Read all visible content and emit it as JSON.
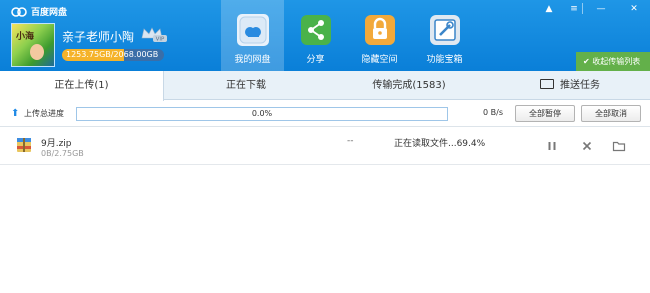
{
  "app": {
    "name": "百度网盘"
  },
  "window_controls": {
    "pin": "▲",
    "menu": "≡",
    "minimize": "—",
    "close": "✕"
  },
  "user": {
    "name": "亲子老师小陶",
    "avatar_text": "小海",
    "badge": "VIP",
    "quota_text": "1253.75GB/2068.00GB",
    "quota_used_fraction": 0.606,
    "quota_color": "#f5b32a"
  },
  "nav": [
    {
      "label": "我的网盘",
      "icon": "folder-cloud-icon",
      "active": true
    },
    {
      "label": "分享",
      "icon": "share-icon",
      "active": false
    },
    {
      "label": "隐藏空间",
      "icon": "lock-icon",
      "active": false
    },
    {
      "label": "功能宝箱",
      "icon": "toolbox-icon",
      "active": false
    }
  ],
  "transfer_list_button": "✔ 收起传输列表",
  "tabs": [
    {
      "label": "正在上传(1)",
      "active": true
    },
    {
      "label": "正在下载",
      "active": false
    },
    {
      "label": "传输完成(1583)",
      "active": false
    },
    {
      "label": "推送任务",
      "active": false
    }
  ],
  "progress": {
    "label": "上传总进度",
    "percent_text": "0.0%",
    "percent": 0.0,
    "speed": "0 B/s",
    "pause_all": "全部暂停",
    "cancel_all": "全部取消"
  },
  "files": [
    {
      "name": "9月.zip",
      "size": "0B/2.75GB",
      "speed": "--",
      "status": "正在读取文件...69.4%",
      "icon": "zip-archive-icon"
    }
  ],
  "colors": {
    "header": "#0a7fd8",
    "accent_green": "#63b04a",
    "progress_fill": "#5aa9e6"
  }
}
